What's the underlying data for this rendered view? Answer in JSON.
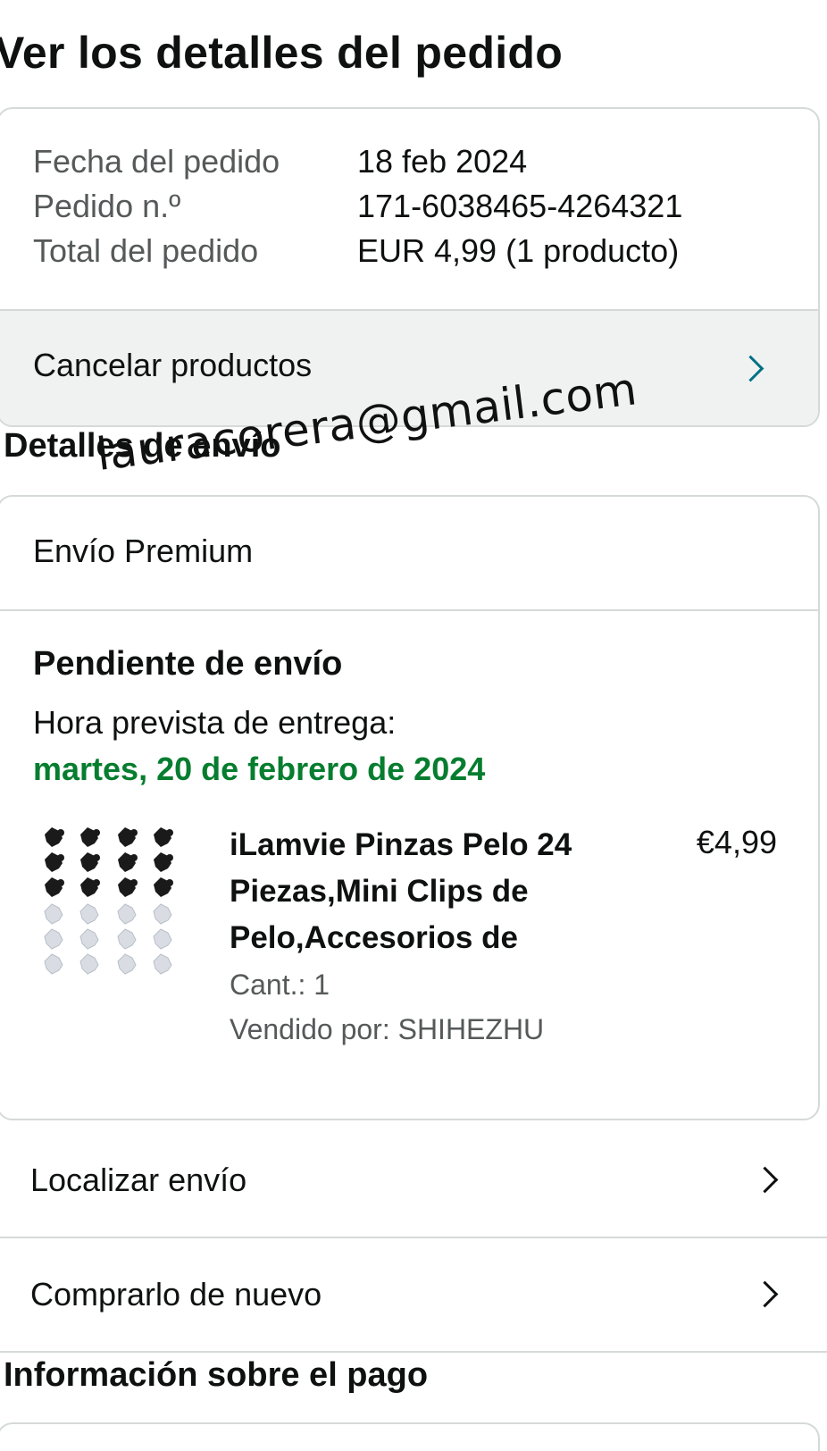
{
  "page_title": "Ver los detalles del pedido",
  "summary": {
    "order_date_label": "Fecha del pedido",
    "order_date_value": "18 feb 2024",
    "order_number_label": "Pedido n.º",
    "order_number_value": "171-6038465-4264321",
    "order_total_label": "Total del pedido",
    "order_total_value": "EUR 4,99 (1 producto)",
    "cancel_label": "Cancelar productos"
  },
  "shipping_details": {
    "heading": "Detalles de envío",
    "handwritten_note": "lauracorera@gmail.com",
    "method": "Envío Premium",
    "status": "Pendiente de envío",
    "eta_label": "Hora prevista de entrega:",
    "eta_date": "martes, 20 de febrero de 2024",
    "eta_color": "#067d2f"
  },
  "product": {
    "title": "iLamvie Pinzas Pelo 24 Piezas,Mini Clips de Pelo,Accesorios de",
    "price": "€4,99",
    "quantity": "Cant.: 1",
    "seller": "Vendido por: SHIHEZHU",
    "thumbnail_icon": "hair-clips-product-image"
  },
  "actions": {
    "track_label": "Localizar envío",
    "buy_again_label": "Comprarlo de nuevo"
  },
  "payment": {
    "heading": "Información sobre el pago"
  }
}
